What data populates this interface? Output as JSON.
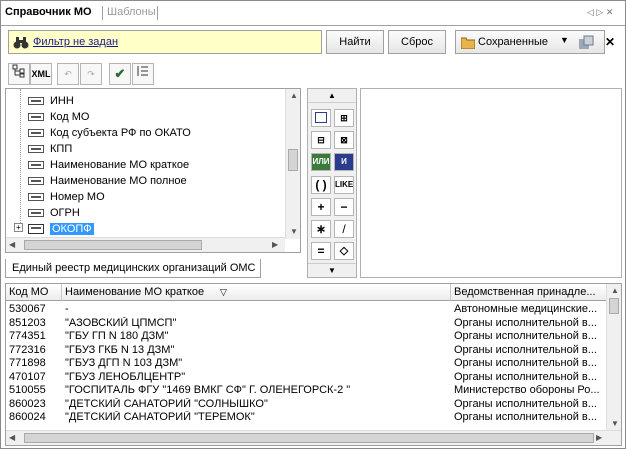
{
  "tabs": {
    "active": "Справочник МО",
    "inactive": "Шаблоны",
    "nav": "◁ ▷ ✕"
  },
  "filter": {
    "text": "Фильтр не задан"
  },
  "buttons": {
    "find": "Найти",
    "reset": "Сброс",
    "saved": "Сохраненные"
  },
  "tree": {
    "items": [
      "ИНН",
      "Код МО",
      "Код субъекта РФ по ОКАТО",
      "КПП",
      "Наименование МО краткое",
      "Наименование МО полное",
      "Номер МО",
      "ОГРН",
      "ОКОПФ"
    ]
  },
  "registry_tab": "Единый реестр медицинских организаций ОМС",
  "operators": {
    "or": "ИЛИ",
    "and": "И",
    "paren": "( )",
    "like": "LIKE",
    "plus": "+",
    "minus": "−",
    "mul": "∗",
    "div": "/",
    "eq": "=",
    "ne": "◇"
  },
  "grid": {
    "headers": [
      "Код МО",
      "Наименование МО краткое",
      "Ведомственная принадле..."
    ],
    "rows": [
      [
        "530067",
        "-",
        "Автономные медицинские..."
      ],
      [
        "851203",
        "\"АЗОВСКИЙ ЦПМСП\"",
        "Органы исполнительной в..."
      ],
      [
        "774351",
        "\"ГБУ ГП N 180 ДЗМ\"",
        "Органы исполнительной в..."
      ],
      [
        "772316",
        "\"ГБУЗ ГКБ N 13 ДЗМ\"",
        "Органы исполнительной в..."
      ],
      [
        "771898",
        "\"ГБУЗ ДГП N 103 ДЗМ\"",
        "Органы исполнительной в..."
      ],
      [
        "470107",
        "\"ГБУЗ ЛЕНОБЛЦЕНТР\"",
        "Органы исполнительной в..."
      ],
      [
        "510055",
        "\"ГОСПИТАЛЬ ФГУ \"1469 ВМКГ СФ\" Г. ОЛЕНЕГОРСК-2 \"",
        "Министерство обороны Ро..."
      ],
      [
        "860023",
        "\"ДЕТСКИЙ САНАТОРИЙ \"СОЛНЫШКО\"",
        "Органы исполнительной в..."
      ],
      [
        "860024",
        "\"ДЕТСКИЙ САНАТОРИЙ \"ТЕРЕМОК\"",
        "Органы исполнительной в..."
      ]
    ]
  }
}
